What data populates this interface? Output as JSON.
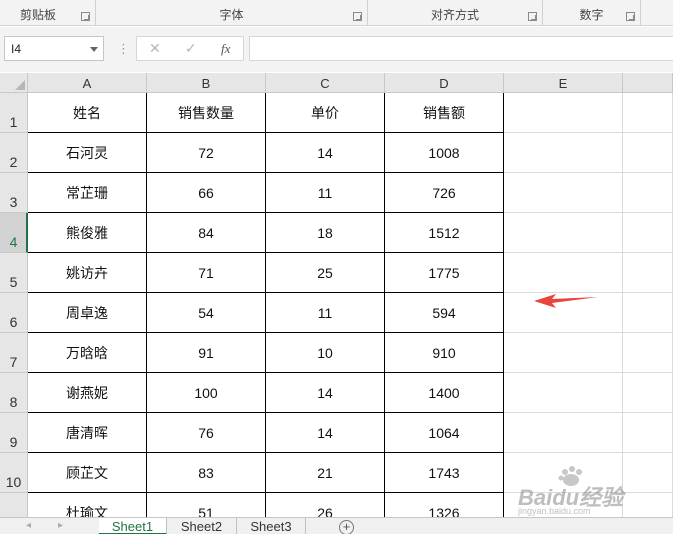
{
  "ribbon": {
    "groups": [
      {
        "label": "剪贴板"
      },
      {
        "label": "字体"
      },
      {
        "label": "对齐方式"
      },
      {
        "label": "数字"
      }
    ]
  },
  "formula_bar": {
    "name_box": "I4",
    "cancel_icon": "x-icon",
    "enter_icon": "check-icon",
    "fx_label": "fx",
    "formula": ""
  },
  "columns": [
    "A",
    "B",
    "C",
    "D",
    "E"
  ],
  "rows": [
    "1",
    "2",
    "3",
    "4",
    "5",
    "6",
    "7",
    "8",
    "9",
    "10"
  ],
  "selected_row": "4",
  "table": {
    "headers": [
      "姓名",
      "销售数量",
      "单价",
      "销售额"
    ],
    "rows": [
      [
        "石河灵",
        "72",
        "14",
        "1008"
      ],
      [
        "常芷珊",
        "66",
        "11",
        "726"
      ],
      [
        "熊俊雅",
        "84",
        "18",
        "1512"
      ],
      [
        "姚访卉",
        "71",
        "25",
        "1775"
      ],
      [
        "周卓逸",
        "54",
        "11",
        "594"
      ],
      [
        "万晗晗",
        "91",
        "10",
        "910"
      ],
      [
        "谢燕妮",
        "100",
        "14",
        "1400"
      ],
      [
        "唐清晖",
        "76",
        "14",
        "1064"
      ],
      [
        "顾芷文",
        "83",
        "21",
        "1743"
      ],
      [
        "杜瑜文",
        "51",
        "26",
        "1326"
      ]
    ]
  },
  "sheets": {
    "tabs": [
      "Sheet1",
      "Sheet2",
      "Sheet3"
    ],
    "active": "Sheet1",
    "add_label": "+"
  },
  "annotation": {
    "arrow_color": "#e8453c",
    "icon": "red-arrow-icon"
  },
  "watermark": {
    "text": "Baidu经验",
    "sub": "jingyan.baidu.com"
  },
  "colors": {
    "accent": "#217346",
    "header_bg": "#e6e6e6",
    "ribbon_bg": "#f3f3f3"
  }
}
